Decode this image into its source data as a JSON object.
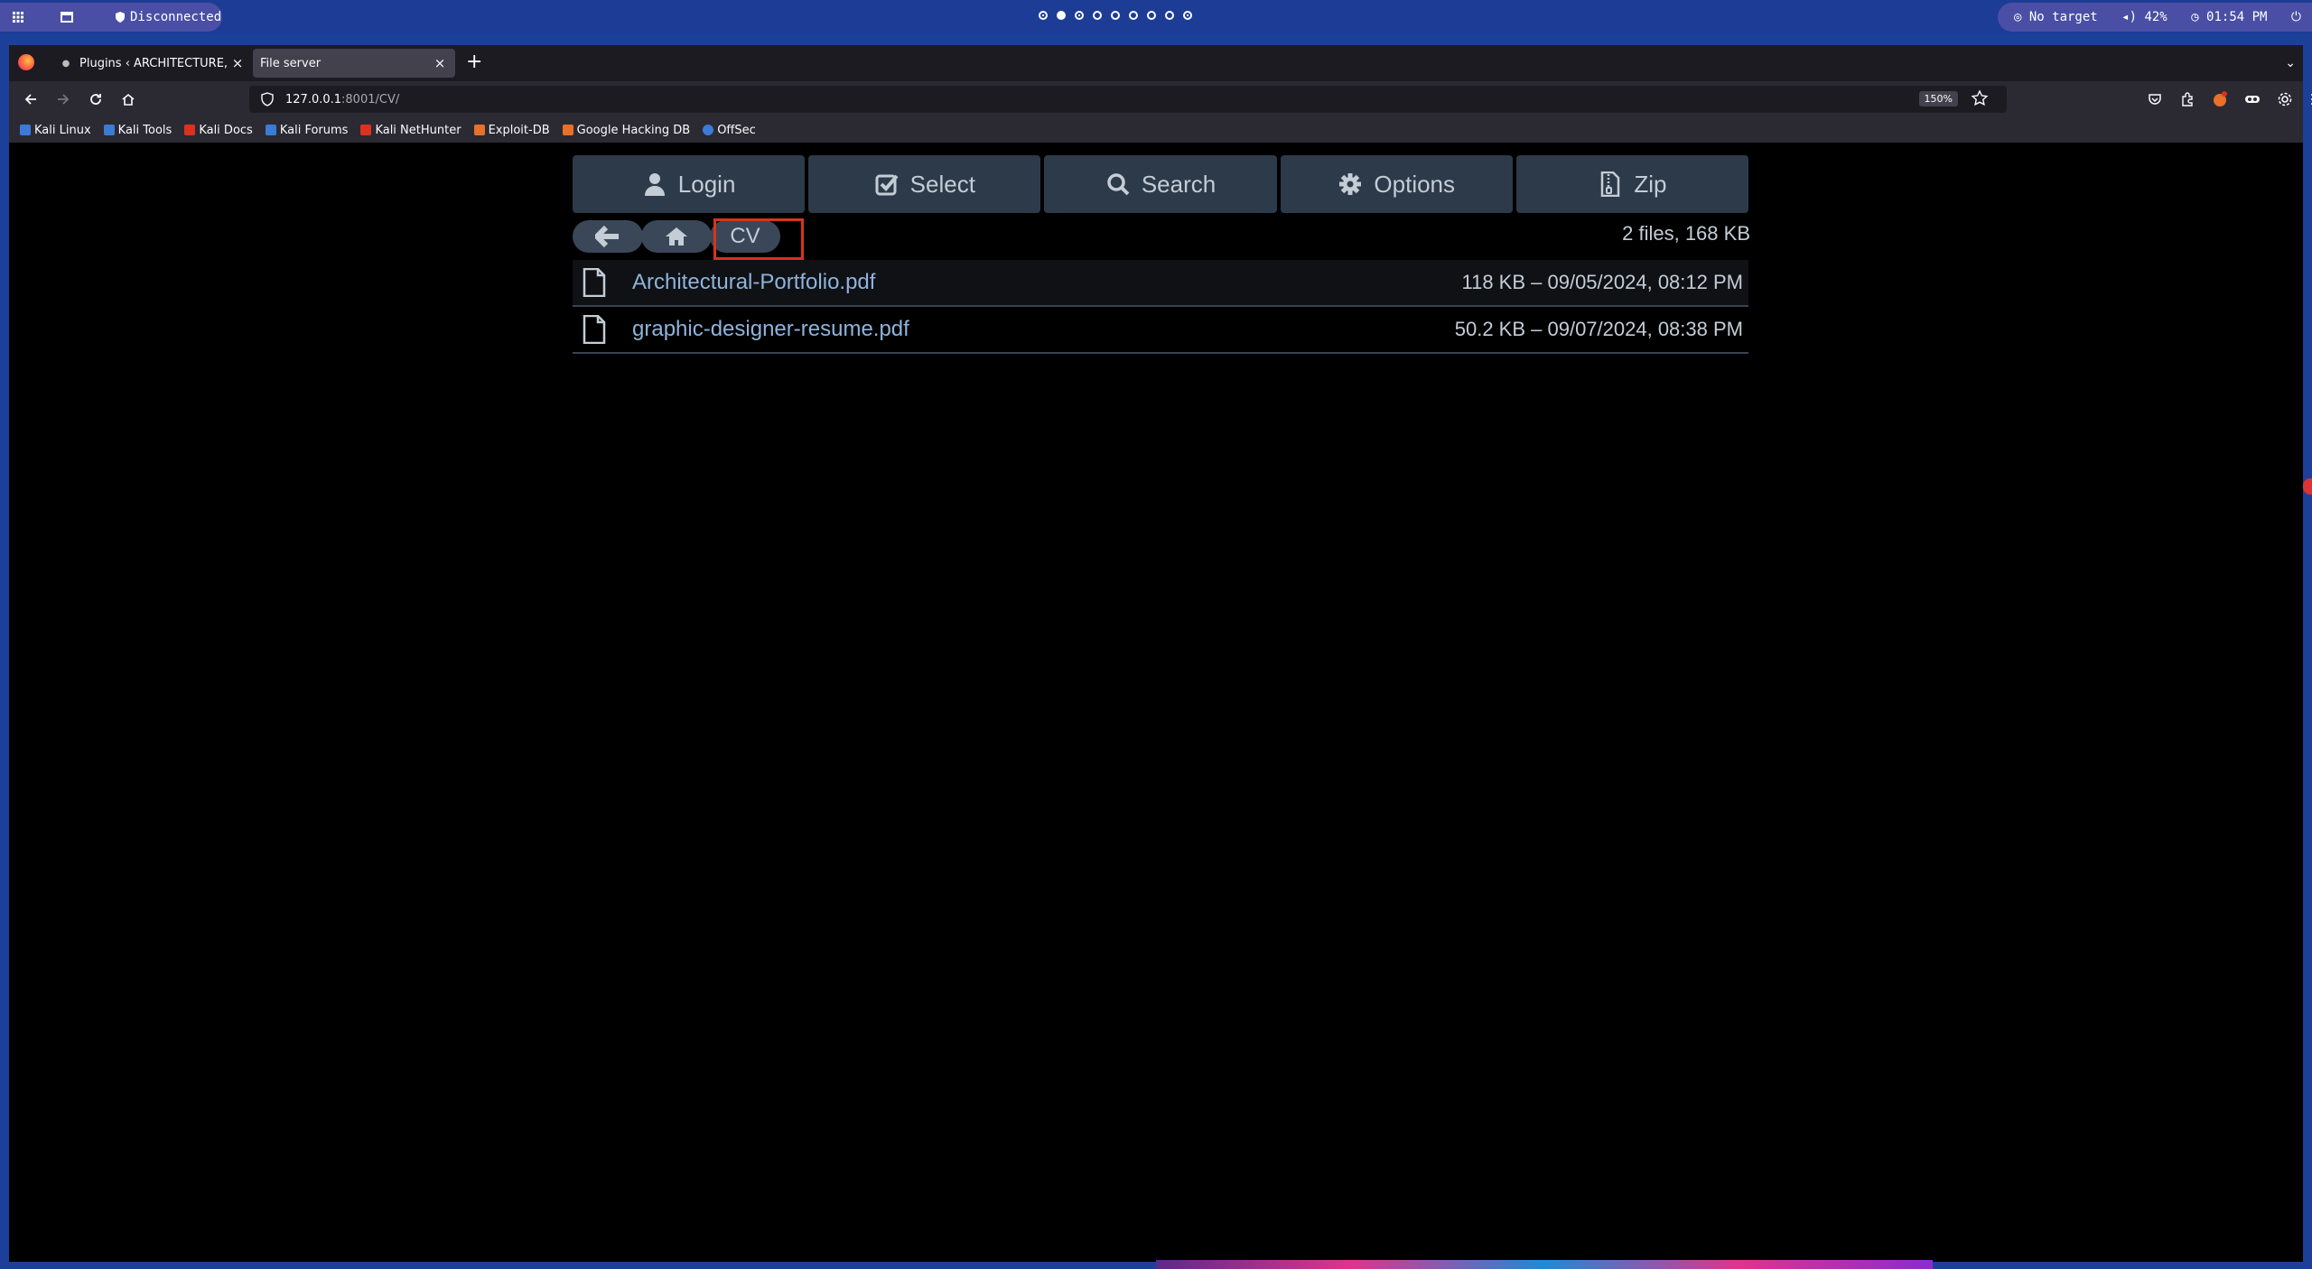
{
  "system_bar": {
    "status": "Disconnected",
    "target": "No target",
    "volume": "42%",
    "time": "01:54 PM"
  },
  "browser": {
    "tabs": [
      {
        "title": "Plugins ‹ ARCHITECTURE, D"
      },
      {
        "title": "File server"
      }
    ],
    "url_host": "127.0.0.1",
    "url_rest": ":8001/CV/",
    "zoom": "150%",
    "bookmarks": [
      {
        "label": "Kali Linux",
        "color": "#3b7bd6"
      },
      {
        "label": "Kali Tools",
        "color": "#3b7bd6"
      },
      {
        "label": "Kali Docs",
        "color": "#d9321e"
      },
      {
        "label": "Kali Forums",
        "color": "#3b7bd6"
      },
      {
        "label": "Kali NetHunter",
        "color": "#d9321e"
      },
      {
        "label": "Exploit-DB",
        "color": "#e8702a"
      },
      {
        "label": "Google Hacking DB",
        "color": "#e8702a"
      },
      {
        "label": "OffSec",
        "color": "#3b7bd6"
      }
    ]
  },
  "page": {
    "toolbar": {
      "login": "Login",
      "select": "Select",
      "search": "Search",
      "options": "Options",
      "zip": "Zip"
    },
    "breadcrumb_current": "CV",
    "summary": "2 files, 168 KB",
    "files": [
      {
        "name": "Architectural-Portfolio.pdf",
        "meta": "118 KB – 09/05/2024, 08:12 PM"
      },
      {
        "name": "graphic-designer-resume.pdf",
        "meta": "50.2 KB – 09/07/2024, 08:38 PM"
      }
    ]
  }
}
